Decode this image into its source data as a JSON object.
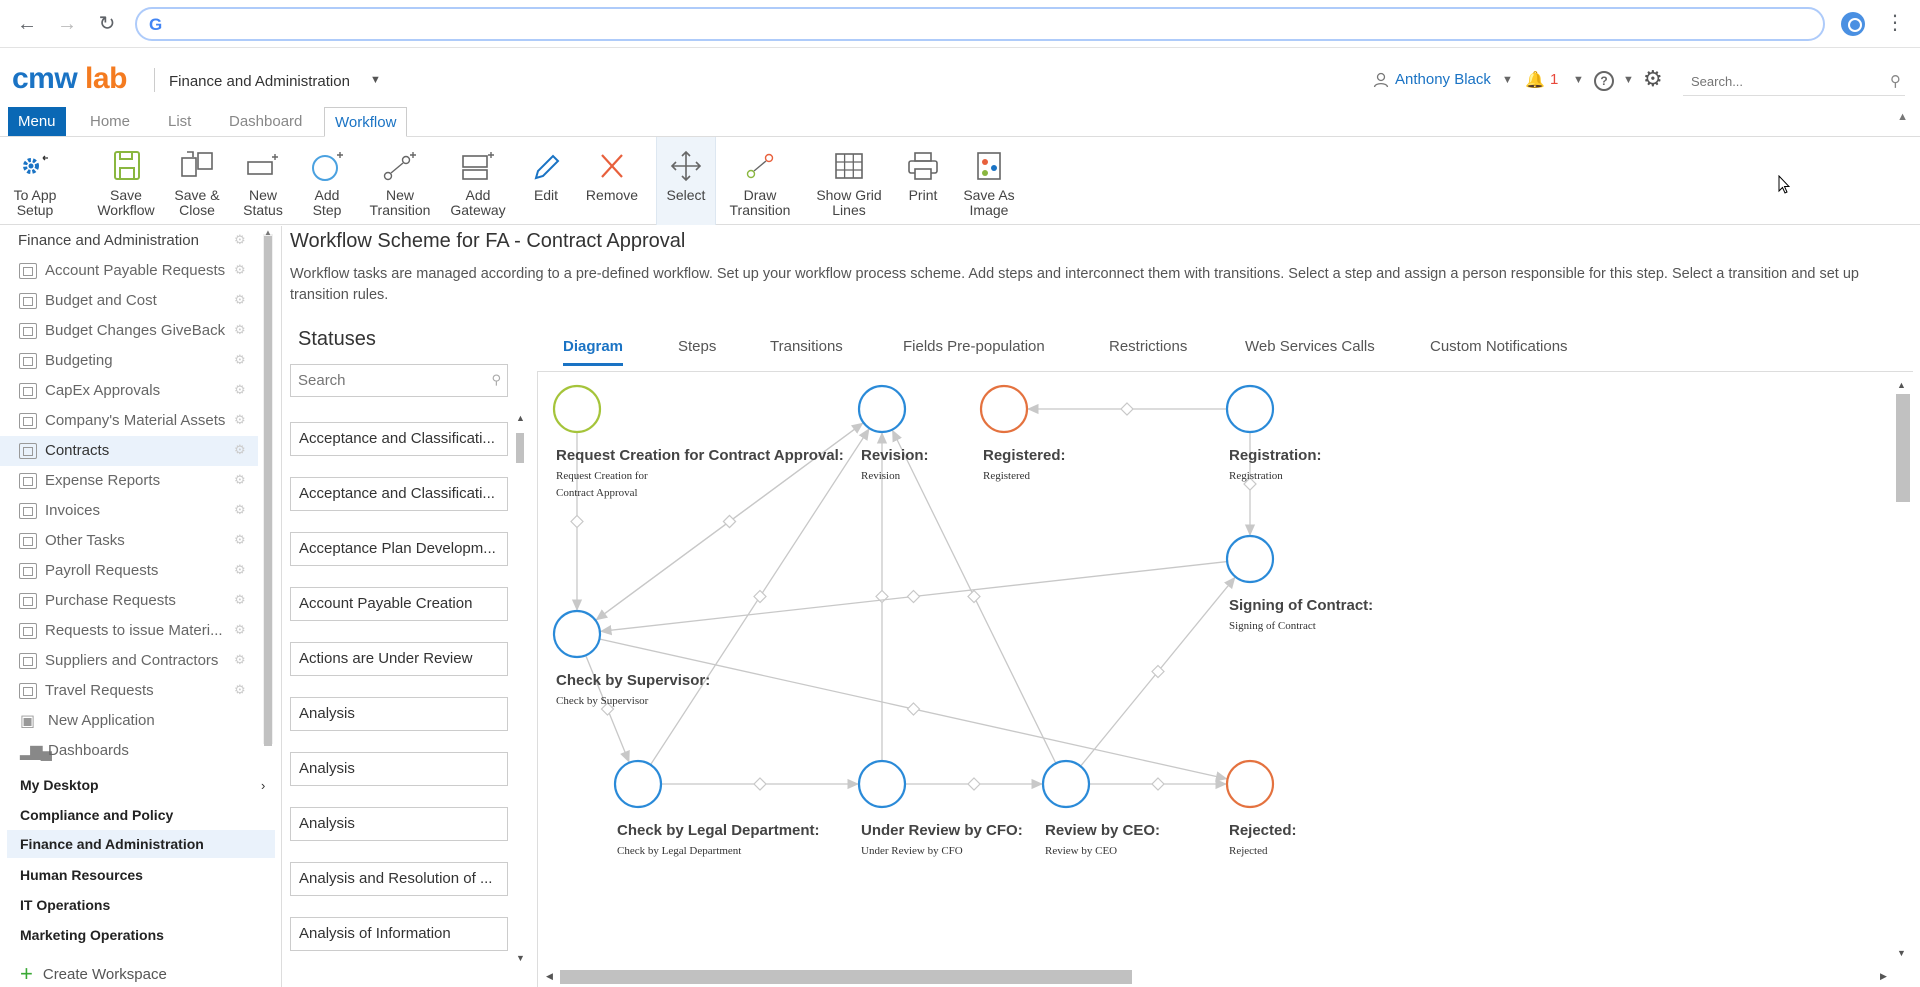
{
  "browser": {
    "address": ""
  },
  "header": {
    "logo_a": "cmw",
    "logo_b": "lab",
    "workspace": "Finance and Administration",
    "user": "Anthony Black",
    "notifications": "1",
    "search_placeholder": "Search..."
  },
  "tabs": {
    "menu": "Menu",
    "home": "Home",
    "list": "List",
    "dashboard": "Dashboard",
    "workflow": "Workflow"
  },
  "ribbon": [
    {
      "label1": "To App",
      "label2": "Setup",
      "icon": "gear-back-icon"
    },
    {
      "label1": "Save",
      "label2": "Workflow",
      "icon": "save-icon"
    },
    {
      "label1": "Save &",
      "label2": "Close",
      "icon": "save-close-icon"
    },
    {
      "label1": "New",
      "label2": "Status",
      "icon": "new-status-icon"
    },
    {
      "label1": "Add",
      "label2": "Step",
      "icon": "add-step-icon"
    },
    {
      "label1": "New",
      "label2": "Transition",
      "icon": "new-transition-icon"
    },
    {
      "label1": "Add",
      "label2": "Gateway",
      "icon": "add-gateway-icon"
    },
    {
      "label1": "Edit",
      "label2": "",
      "icon": "edit-icon"
    },
    {
      "label1": "Remove",
      "label2": "",
      "icon": "remove-icon"
    },
    {
      "label1": "Select",
      "label2": "",
      "icon": "select-icon"
    },
    {
      "label1": "Draw",
      "label2": "Transition",
      "icon": "draw-transition-icon"
    },
    {
      "label1": "Show Grid",
      "label2": "Lines",
      "icon": "grid-icon"
    },
    {
      "label1": "Print",
      "label2": "",
      "icon": "print-icon"
    },
    {
      "label1": "Save As",
      "label2": "Image",
      "icon": "save-image-icon"
    }
  ],
  "nav": {
    "heading": "Finance and Administration",
    "items": [
      "Account Payable Requests",
      "Budget and Cost",
      "Budget Changes GiveBack",
      "Budgeting",
      "CapEx Approvals",
      "Company's Material Assets",
      "Contracts",
      "Expense Reports",
      "Invoices",
      "Other Tasks",
      "Payroll Requests",
      "Purchase Requests",
      "Requests to issue Materi...",
      "Suppliers and Contractors",
      "Travel Requests"
    ],
    "new_application": "New Application",
    "dashboards": "Dashboards",
    "groups": [
      "My Desktop",
      "Compliance and Policy",
      "Finance and Administration",
      "Human Resources",
      "IT Operations",
      "Marketing Operations"
    ],
    "create_workspace": "Create Workspace"
  },
  "content": {
    "title": "Workflow Scheme for FA - Contract Approval",
    "description": "Workflow tasks are managed according to a pre-defined workflow. Set up your workflow process scheme. Add steps and interconnect them with transitions. Select a step and assign a person responsible for this step. Select a transition and set up transition rules."
  },
  "statuses": {
    "title": "Statuses",
    "search_placeholder": "Search",
    "items": [
      "Acceptance and Classificati...",
      "Acceptance and Classificati...",
      "Acceptance Plan Developm...",
      "Account Payable Creation",
      "Actions are Under Review",
      "Analysis",
      "Analysis",
      "Analysis",
      "Analysis and Resolution of ...",
      "Analysis of Information"
    ]
  },
  "diagram_tabs": [
    "Diagram",
    "Steps",
    "Transitions",
    "Fields Pre-population",
    "Restrictions",
    "Web Services Calls",
    "Custom Notifications"
  ],
  "diagram": {
    "colors": {
      "step": "#2a8ad8",
      "end": "#e4723f",
      "start": "#a5c43a",
      "line": "#c8c8c8"
    },
    "nodes": [
      {
        "id": "req",
        "title": "Request Creation for Contract Approval:",
        "sub1": "Request Creation for",
        "sub2": "Contract Approval",
        "kind": "start"
      },
      {
        "id": "rev",
        "title": "Revision:",
        "sub1": "Revision",
        "sub2": "",
        "kind": "step"
      },
      {
        "id": "regd",
        "title": "Registered:",
        "sub1": "Registered",
        "sub2": "",
        "kind": "end"
      },
      {
        "id": "regn",
        "title": "Registration:",
        "sub1": "Registration",
        "sub2": "",
        "kind": "step"
      },
      {
        "id": "sign",
        "title": "Signing of Contract:",
        "sub1": "Signing of Contract",
        "sub2": "",
        "kind": "step"
      },
      {
        "id": "sup",
        "title": "Check by Supervisor:",
        "sub1": "Check by Supervisor",
        "sub2": "",
        "kind": "step"
      },
      {
        "id": "legal",
        "title": "Check by Legal Department:",
        "sub1": "Check by Legal Department",
        "sub2": "",
        "kind": "step"
      },
      {
        "id": "cfo",
        "title": "Under Review by CFO:",
        "sub1": "Under Review by CFO",
        "sub2": "",
        "kind": "step"
      },
      {
        "id": "ceo",
        "title": "Review by CEO:",
        "sub1": "Review by CEO",
        "sub2": "",
        "kind": "step"
      },
      {
        "id": "rej",
        "title": "Rejected:",
        "sub1": "Rejected",
        "sub2": "",
        "kind": "end"
      }
    ],
    "edges": [
      [
        "req",
        "sup"
      ],
      [
        "sup",
        "rev"
      ],
      [
        "rev",
        "sup"
      ],
      [
        "sup",
        "legal"
      ],
      [
        "legal",
        "rev"
      ],
      [
        "legal",
        "cfo"
      ],
      [
        "cfo",
        "ceo"
      ],
      [
        "ceo",
        "rej"
      ],
      [
        "cfo",
        "rev"
      ],
      [
        "ceo",
        "rev"
      ],
      [
        "ceo",
        "sign"
      ],
      [
        "sign",
        "sup"
      ],
      [
        "sup",
        "rej"
      ],
      [
        "regn",
        "regd"
      ],
      [
        "regn",
        "sign"
      ]
    ]
  }
}
